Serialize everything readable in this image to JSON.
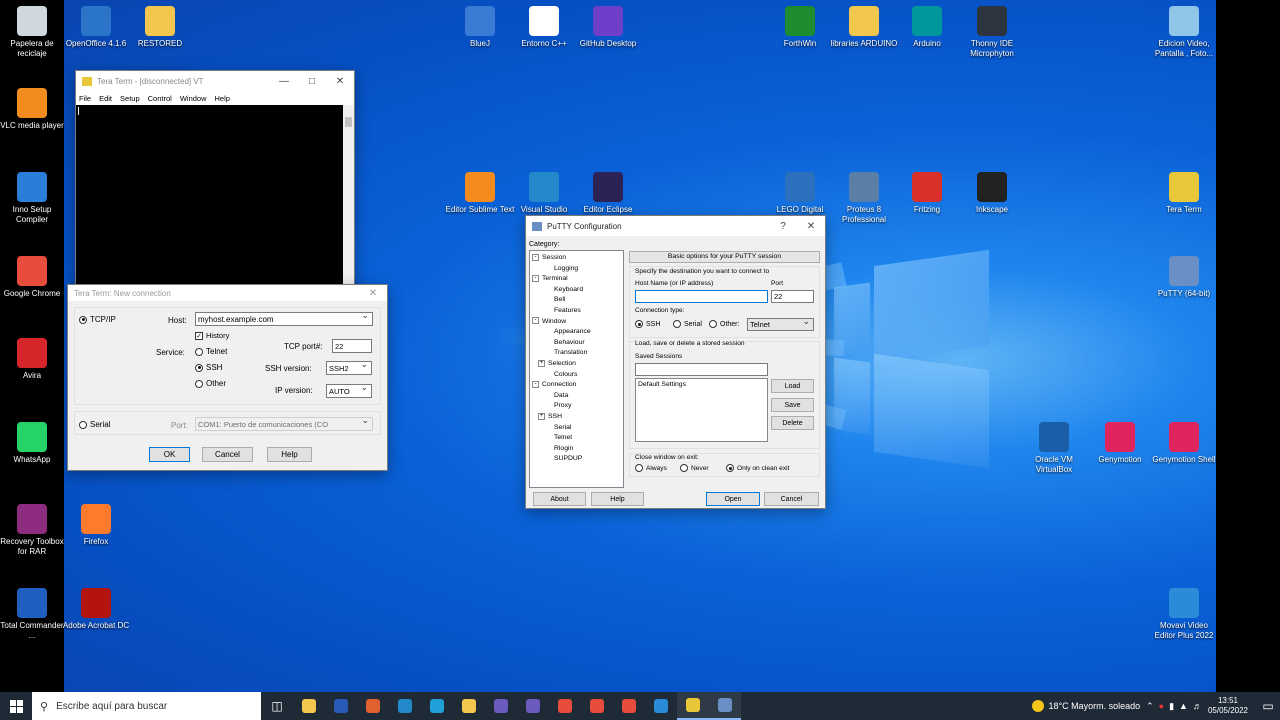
{
  "desktop_icons_left": [
    {
      "label": "Papelera de reciclaje",
      "icon": "recycle-bin-icon",
      "color": "#cfd8dc"
    },
    {
      "label": "VLC media player",
      "icon": "vlc-icon",
      "color": "#f28c1e"
    },
    {
      "label": "Inno Setup Compiler",
      "icon": "inno-setup-icon",
      "color": "#2a7ed8"
    },
    {
      "label": "Google Chrome",
      "icon": "chrome-icon",
      "color": "#e74c3c"
    },
    {
      "label": "Avira",
      "icon": "avira-icon",
      "color": "#d7262b"
    },
    {
      "label": "WhatsApp",
      "icon": "whatsapp-icon",
      "color": "#25d366"
    },
    {
      "label": "Recovery Toolbox for RAR",
      "icon": "recovery-toolbox-icon",
      "color": "#8e2c7f"
    },
    {
      "label": "Total Commander ...",
      "icon": "total-commander-icon",
      "color": "#1f5fbf"
    }
  ],
  "desktop_icons_other": [
    {
      "label": "OpenOffice 4.1.6",
      "icon": "openoffice-icon",
      "color": "#2a74c9"
    },
    {
      "label": "RESTORED",
      "icon": "folder-icon",
      "color": "#f3c64e"
    },
    {
      "label": "Firefox",
      "icon": "firefox-icon",
      "color": "#ff7a2a"
    },
    {
      "label": "Adobe Acrobat DC",
      "icon": "acrobat-icon",
      "color": "#b3140e"
    },
    {
      "label": "BlueJ",
      "icon": "bluej-icon",
      "color": "#3a7bd5"
    },
    {
      "label": "Entorno C++",
      "icon": "cpp-env-icon",
      "color": "#ffffff"
    },
    {
      "label": "GitHub Desktop",
      "icon": "github-icon",
      "color": "#6e40c9"
    },
    {
      "label": "ForthWin",
      "icon": "forthwin-icon",
      "color": "#1e8c2e"
    },
    {
      "label": "libraries ARDUINO",
      "icon": "folder-icon",
      "color": "#f3c64e"
    },
    {
      "label": "Arduino",
      "icon": "arduino-icon",
      "color": "#00979c"
    },
    {
      "label": "Thonny IDE Microphyton",
      "icon": "thonny-icon",
      "color": "#2f3540"
    },
    {
      "label": "Edicion Video, Pantalla , Foto...",
      "icon": "folder-icon",
      "color": "#8fc6e8"
    },
    {
      "label": "Editor Sublime Text",
      "icon": "sublime-icon",
      "color": "#f38b1e"
    },
    {
      "label": "Visual Studio",
      "icon": "vscode-icon",
      "color": "#2489ca"
    },
    {
      "label": "Editor Eclipse",
      "icon": "eclipse-icon",
      "color": "#2c2255"
    },
    {
      "label": "LEGO Digital",
      "icon": "lego-icon",
      "color": "#2c6fbd"
    },
    {
      "label": "Proteus 8 Professional",
      "icon": "proteus-icon",
      "color": "#5a7fa6"
    },
    {
      "label": "Fritzing",
      "icon": "fritzing-icon",
      "color": "#d9312a"
    },
    {
      "label": "Inkscape",
      "icon": "inkscape-icon",
      "color": "#222222"
    },
    {
      "label": "Tera Term",
      "icon": "teraterm-icon",
      "color": "#e8c838"
    },
    {
      "label": "PuTTY (64-bit)",
      "icon": "putty-icon",
      "color": "#6a8fc4"
    },
    {
      "label": "Oracle VM VirtualBox",
      "icon": "virtualbox-icon",
      "color": "#1b5ea8"
    },
    {
      "label": "Genymotion",
      "icon": "genymotion-icon",
      "color": "#e0245e"
    },
    {
      "label": "Genymotion Shell",
      "icon": "genymotion-shell-icon",
      "color": "#e0245e"
    },
    {
      "label": "Movavi Video Editor Plus 2022",
      "icon": "movavi-icon",
      "color": "#2a8cd8"
    }
  ],
  "teraterm": {
    "title": "Tera Term - [disconnected] VT",
    "menu": [
      "File",
      "Edit",
      "Setup",
      "Control",
      "Window",
      "Help"
    ]
  },
  "newconn": {
    "title": "Tera Term: New connection",
    "tcpip_label": "TCP/IP",
    "host_label": "Host:",
    "host_value": "myhost.example.com",
    "history_label": "History",
    "service_label": "Service:",
    "telnet_label": "Telnet",
    "ssh_label": "SSH",
    "other_label": "Other",
    "tcpport_label": "TCP port#:",
    "tcpport_value": "22",
    "sshversion_label": "SSH version:",
    "sshversion_value": "SSH2",
    "ipversion_label": "IP version:",
    "ipversion_value": "AUTO",
    "serial_label": "Serial",
    "port_label": "Port:",
    "port_value": "COM1: Puerto de comunicaciones (CO",
    "ok": "OK",
    "cancel": "Cancel",
    "help": "Help"
  },
  "putty": {
    "title": "PuTTY Configuration",
    "help_glyph": "?",
    "category_label": "Category:",
    "tree": [
      {
        "label": "Session",
        "level": 0,
        "exp": "-",
        "selected": true
      },
      {
        "label": "Logging",
        "level": 2,
        "exp": ""
      },
      {
        "label": "Terminal",
        "level": 0,
        "exp": "-"
      },
      {
        "label": "Keyboard",
        "level": 2,
        "exp": ""
      },
      {
        "label": "Bell",
        "level": 2,
        "exp": ""
      },
      {
        "label": "Features",
        "level": 2,
        "exp": ""
      },
      {
        "label": "Window",
        "level": 0,
        "exp": "-"
      },
      {
        "label": "Appearance",
        "level": 2,
        "exp": ""
      },
      {
        "label": "Behaviour",
        "level": 2,
        "exp": ""
      },
      {
        "label": "Translation",
        "level": 2,
        "exp": ""
      },
      {
        "label": "Selection",
        "level": 1,
        "exp": "+"
      },
      {
        "label": "Colours",
        "level": 2,
        "exp": ""
      },
      {
        "label": "Connection",
        "level": 0,
        "exp": "-"
      },
      {
        "label": "Data",
        "level": 2,
        "exp": ""
      },
      {
        "label": "Proxy",
        "level": 2,
        "exp": ""
      },
      {
        "label": "SSH",
        "level": 1,
        "exp": "+"
      },
      {
        "label": "Serial",
        "level": 2,
        "exp": ""
      },
      {
        "label": "Telnet",
        "level": 2,
        "exp": ""
      },
      {
        "label": "Rlogin",
        "level": 2,
        "exp": ""
      },
      {
        "label": "SUPDUP",
        "level": 2,
        "exp": ""
      }
    ],
    "header": "Basic options for your PuTTY session",
    "dest_label": "Specify the destination you want to connect to",
    "host_label": "Host Name (or IP address)",
    "host_value": "",
    "port_label": "Port",
    "port_value": "22",
    "conntype_label": "Connection type:",
    "ssh_label": "SSH",
    "serial_label": "Serial",
    "other_label": "Other:",
    "other_value": "Telnet",
    "sessions_group": "Load, save or delete a stored session",
    "saved_label": "Saved Sessions",
    "saved_value": "",
    "sessions": [
      "Default Settings"
    ],
    "load": "Load",
    "save": "Save",
    "delete": "Delete",
    "close_label": "Close window on exit:",
    "always": "Always",
    "never": "Never",
    "clean": "Only on clean exit",
    "about": "About",
    "help": "Help",
    "open": "Open",
    "cancel": "Cancel"
  },
  "taskbar": {
    "search_placeholder": "Escribe aquí para buscar",
    "weather": "18°C  Mayorm. soleado",
    "time": "13:51",
    "date": "05/05/2022"
  }
}
